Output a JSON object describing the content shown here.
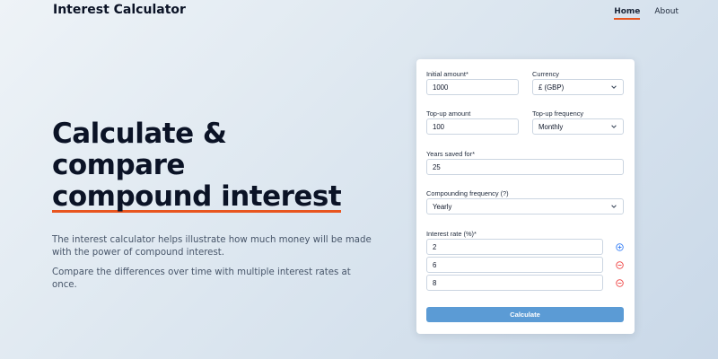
{
  "header": {
    "brand": "Interest Calculator",
    "nav": [
      {
        "label": "Home",
        "active": true
      },
      {
        "label": "About",
        "active": false
      }
    ]
  },
  "hero": {
    "title_line1": "Calculate &",
    "title_line2": "compare",
    "title_line3": "compound interest",
    "description1": "The interest calculator helps illustrate how much money will be made with the power of compound interest.",
    "description2": "Compare the differences over time with multiple interest rates at once."
  },
  "form": {
    "initial_amount": {
      "label": "Initial amount*",
      "value": "1000"
    },
    "currency": {
      "label": "Currency",
      "value": "£ (GBP)"
    },
    "topup_amount": {
      "label": "Top-up amount",
      "value": "100"
    },
    "topup_frequency": {
      "label": "Top-up frequency",
      "value": "Monthly"
    },
    "years": {
      "label": "Years saved for*",
      "value": "25"
    },
    "compounding": {
      "label": "Compounding frequency (?)",
      "value": "Yearly"
    },
    "interest_rate_label": "Interest rate (%)*",
    "rates": [
      {
        "value": "2",
        "action": "add"
      },
      {
        "value": "6",
        "action": "remove"
      },
      {
        "value": "8",
        "action": "remove"
      }
    ],
    "calculate_label": "Calculate"
  },
  "colors": {
    "accent": "#e8551f",
    "button": "#5b9bd5",
    "add_icon": "#3b82f6",
    "remove_icon": "#ef4444"
  }
}
